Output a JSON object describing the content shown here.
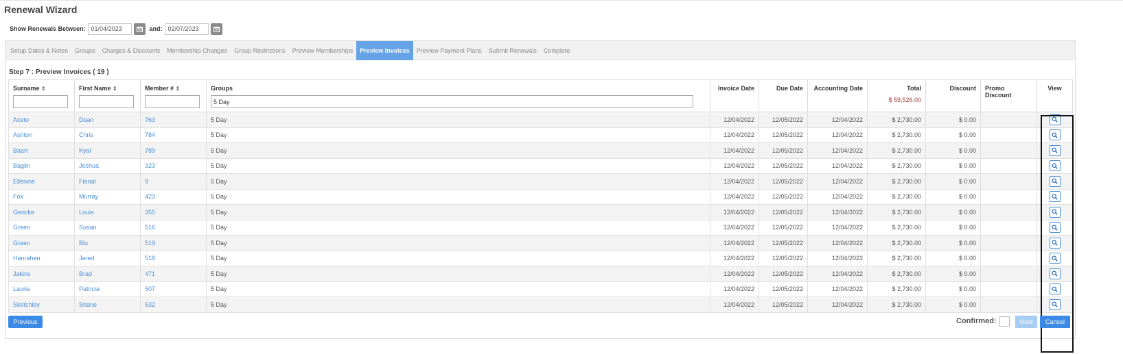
{
  "header": {
    "title": "Renewal Wizard"
  },
  "date_filter": {
    "label_between": "Show Renewals Between:",
    "from": "01/04/2023",
    "label_and": "and:",
    "to": "02/07/2023",
    "icon": "calendar-icon"
  },
  "tabs": [
    {
      "label": "Setup Dates & Notes"
    },
    {
      "label": "Groups"
    },
    {
      "label": "Charges & Discounts"
    },
    {
      "label": "Membership Changes"
    },
    {
      "label": "Group Restrictions"
    },
    {
      "label": "Preview Memberships"
    },
    {
      "label": "Preview Invoices"
    },
    {
      "label": "Preview Payment Plans"
    },
    {
      "label": "Submit Renewals"
    },
    {
      "label": "Complete"
    }
  ],
  "active_tab": "Preview Invoices",
  "step_title": "Step 7 : Preview Invoices ( 19 )",
  "table": {
    "columns": {
      "surname": "Surname",
      "first_name": "First Name",
      "member_no": "Member #",
      "groups": "Groups",
      "invoice_date": "Invoice Date",
      "due_date": "Due Date",
      "accounting_date": "Accounting Date",
      "total": "Total",
      "discount": "Discount",
      "promo_discount": "Promo Discount",
      "view": "View"
    },
    "sort_glyph": "⇕",
    "groups_filter_value": "5 Day",
    "total_sum": "$ 59,526.00",
    "rows": [
      {
        "surname": "Aceto",
        "first": "Dean",
        "member": "763",
        "groups": "5 Day",
        "invoice_date": "12/04/2022",
        "due_date": "12/05/2022",
        "acct_date": "12/04/2022",
        "total": "$ 2,730.00",
        "discount": "$ 0.00",
        "promo": ""
      },
      {
        "surname": "Ashton",
        "first": "Chris",
        "member": "784",
        "groups": "5 Day",
        "invoice_date": "12/04/2022",
        "due_date": "12/05/2022",
        "acct_date": "12/04/2022",
        "total": "$ 2,730.00",
        "discount": "$ 0.00",
        "promo": ""
      },
      {
        "surname": "Baart",
        "first": "Kyal",
        "member": "789",
        "groups": "5 Day",
        "invoice_date": "12/04/2022",
        "due_date": "12/05/2022",
        "acct_date": "12/04/2022",
        "total": "$ 2,730.00",
        "discount": "$ 0.00",
        "promo": ""
      },
      {
        "surname": "Baglin",
        "first": "Joshua",
        "member": "323",
        "groups": "5 Day",
        "invoice_date": "12/04/2022",
        "due_date": "12/05/2022",
        "acct_date": "12/04/2022",
        "total": "$ 2,730.00",
        "discount": "$ 0.00",
        "promo": ""
      },
      {
        "surname": "Ellenine",
        "first": "Fional",
        "member": "9",
        "groups": "5 Day",
        "invoice_date": "12/04/2022",
        "due_date": "12/05/2022",
        "acct_date": "12/04/2022",
        "total": "$ 2,730.00",
        "discount": "$ 0.00",
        "promo": ""
      },
      {
        "surname": "Fox",
        "first": "Murray",
        "member": "423",
        "groups": "5 Day",
        "invoice_date": "12/04/2022",
        "due_date": "12/05/2022",
        "acct_date": "12/04/2022",
        "total": "$ 2,730.00",
        "discount": "$ 0.00",
        "promo": ""
      },
      {
        "surname": "Gericke",
        "first": "Louis",
        "member": "355",
        "groups": "5 Day",
        "invoice_date": "12/04/2022",
        "due_date": "12/05/2022",
        "acct_date": "12/04/2022",
        "total": "$ 2,730.00",
        "discount": "$ 0.00",
        "promo": ""
      },
      {
        "surname": "Green",
        "first": "Susan",
        "member": "516",
        "groups": "5 Day",
        "invoice_date": "12/04/2022",
        "due_date": "12/05/2022",
        "acct_date": "12/04/2022",
        "total": "$ 2,730.00",
        "discount": "$ 0.00",
        "promo": ""
      },
      {
        "surname": "Green",
        "first": "Blu",
        "member": "519",
        "groups": "5 Day",
        "invoice_date": "12/04/2022",
        "due_date": "12/05/2022",
        "acct_date": "12/04/2022",
        "total": "$ 2,730.00",
        "discount": "$ 0.00",
        "promo": ""
      },
      {
        "surname": "Hanrahan",
        "first": "Jared",
        "member": "518",
        "groups": "5 Day",
        "invoice_date": "12/04/2022",
        "due_date": "12/05/2022",
        "acct_date": "12/04/2022",
        "total": "$ 2,730.00",
        "discount": "$ 0.00",
        "promo": ""
      },
      {
        "surname": "Jakins",
        "first": "Brad",
        "member": "471",
        "groups": "5 Day",
        "invoice_date": "12/04/2022",
        "due_date": "12/05/2022",
        "acct_date": "12/04/2022",
        "total": "$ 2,730.00",
        "discount": "$ 0.00",
        "promo": ""
      },
      {
        "surname": "Laurie",
        "first": "Patricia",
        "member": "507",
        "groups": "5 Day",
        "invoice_date": "12/04/2022",
        "due_date": "12/05/2022",
        "acct_date": "12/04/2022",
        "total": "$ 2,730.00",
        "discount": "$ 0.00",
        "promo": ""
      },
      {
        "surname": "Sketchley",
        "first": "Shane",
        "member": "532",
        "groups": "5 Day",
        "invoice_date": "12/04/2022",
        "due_date": "12/05/2022",
        "acct_date": "12/04/2022",
        "total": "$ 2,730.00",
        "discount": "$ 0.00",
        "promo": ""
      }
    ],
    "view_icon": "search-icon"
  },
  "footer": {
    "previous": "Previous",
    "confirmed_label": "Confirmed:",
    "next": "Next",
    "cancel": "Cancel"
  },
  "colors": {
    "accent": "#3b8ae6",
    "active_tab": "#66a3e6",
    "link": "#4a8fd6",
    "total_sum": "#a33a3a"
  }
}
